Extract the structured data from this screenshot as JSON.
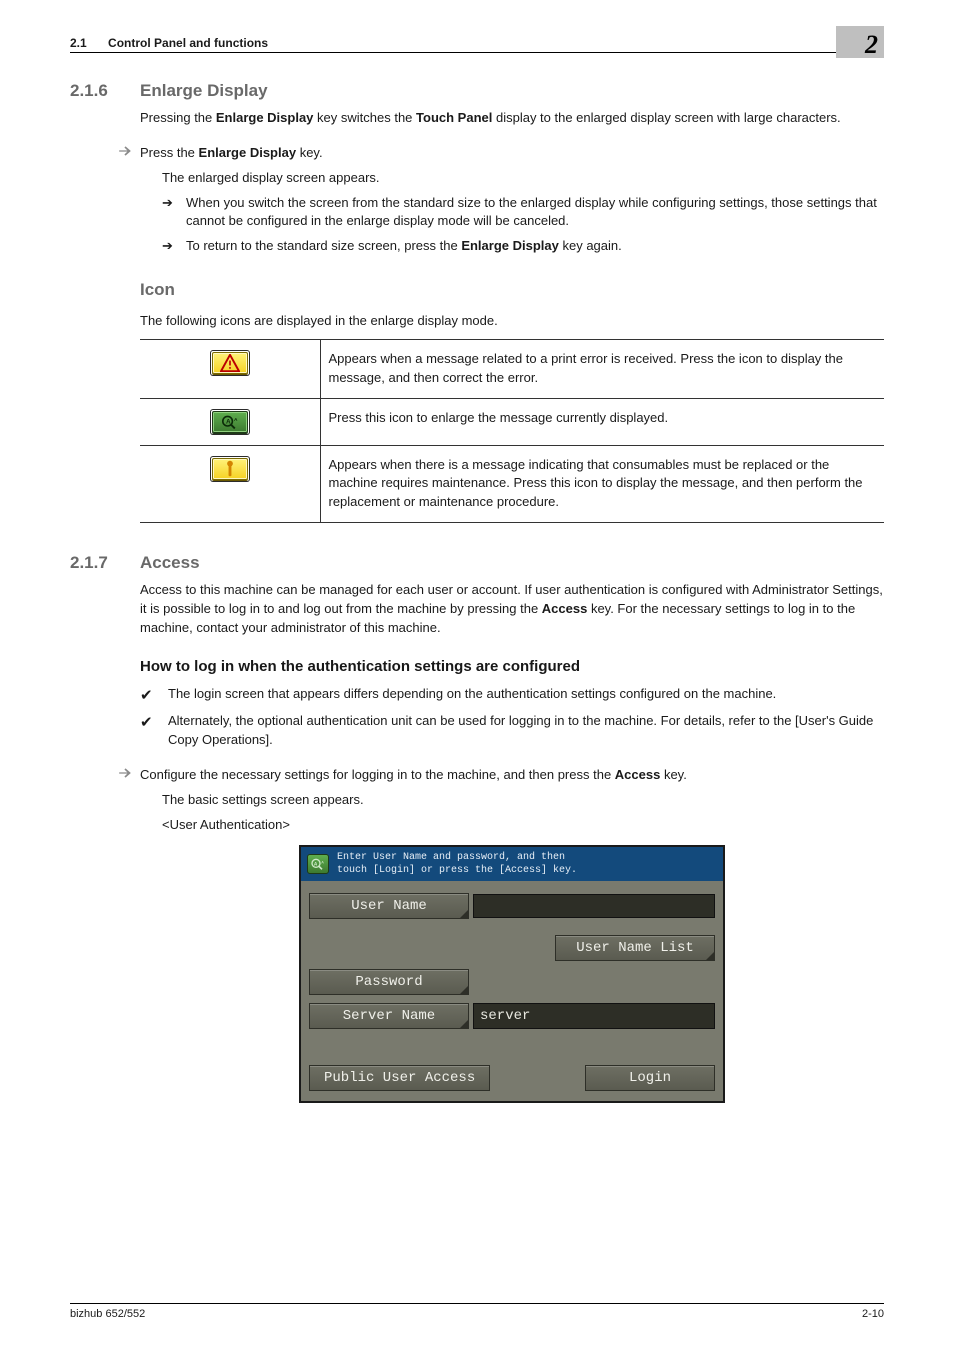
{
  "header": {
    "section_num": "2.1",
    "section_title": "Control Panel and functions",
    "chapter_num": "2"
  },
  "s216": {
    "num": "2.1.6",
    "title": "Enlarge Display",
    "intro_a": "Pressing the ",
    "intro_b": "Enlarge Display",
    "intro_c": " key switches the ",
    "intro_d": "Touch Panel",
    "intro_e": " display to the enlarged display screen with large characters.",
    "step_a": "Press the ",
    "step_b": "Enlarge Display",
    "step_c": " key.",
    "sub1": "The enlarged display screen appears.",
    "b1": "When you switch the screen from the standard size to the enlarged display while configuring settings, those settings that cannot be configured in the enlarge display mode will be canceled.",
    "b2_a": "To return to the standard size screen, press the ",
    "b2_b": "Enlarge Display",
    "b2_c": " key again."
  },
  "icon": {
    "title": "Icon",
    "intro": "The following icons are displayed in the enlarge display mode.",
    "rows": [
      {
        "name": "warning-icon",
        "desc": "Appears when a message related to a print error is received. Press the icon to display the message, and then correct the error."
      },
      {
        "name": "magnify-icon",
        "desc": "Press this icon to enlarge the message currently displayed."
      },
      {
        "name": "maintenance-icon",
        "desc": "Appears when there is a message indicating that consumables must be replaced or the machine requires maintenance. Press this icon to display the message, and then perform the replacement or maintenance procedure."
      }
    ]
  },
  "s217": {
    "num": "2.1.7",
    "title": "Access",
    "p1_a": "Access to this machine can be managed for each user or account. If user authentication is configured with Administrator Settings, it is possible to log in to and log out from the machine by pressing the ",
    "p1_b": "Access",
    "p1_c": " key. For the necessary settings to log in to the machine, contact your administrator of this machine.",
    "h4": "How to log in when the authentication settings are configured",
    "c1": "The login screen that appears differs depending on the authentication settings configured on the machine.",
    "c2": "Alternately, the optional authentication unit can be used for logging in to the machine. For details, refer to the [User's Guide Copy Operations].",
    "step_a": "Configure the necessary settings for logging in to the machine, and then press the ",
    "step_b": "Access",
    "step_c": " key.",
    "sub1": "The basic settings screen appears.",
    "sub2": "<User Authentication>"
  },
  "shot": {
    "hdr1": "Enter User Name and password, and then",
    "hdr2": "touch [Login] or press the [Access] key.",
    "user_name": "User Name",
    "user_name_list": "User Name List",
    "password": "Password",
    "server_name": "Server Name",
    "server_val": "server",
    "public": "Public User Access",
    "login": "Login"
  },
  "footer": {
    "left": "bizhub 652/552",
    "right": "2-10"
  }
}
